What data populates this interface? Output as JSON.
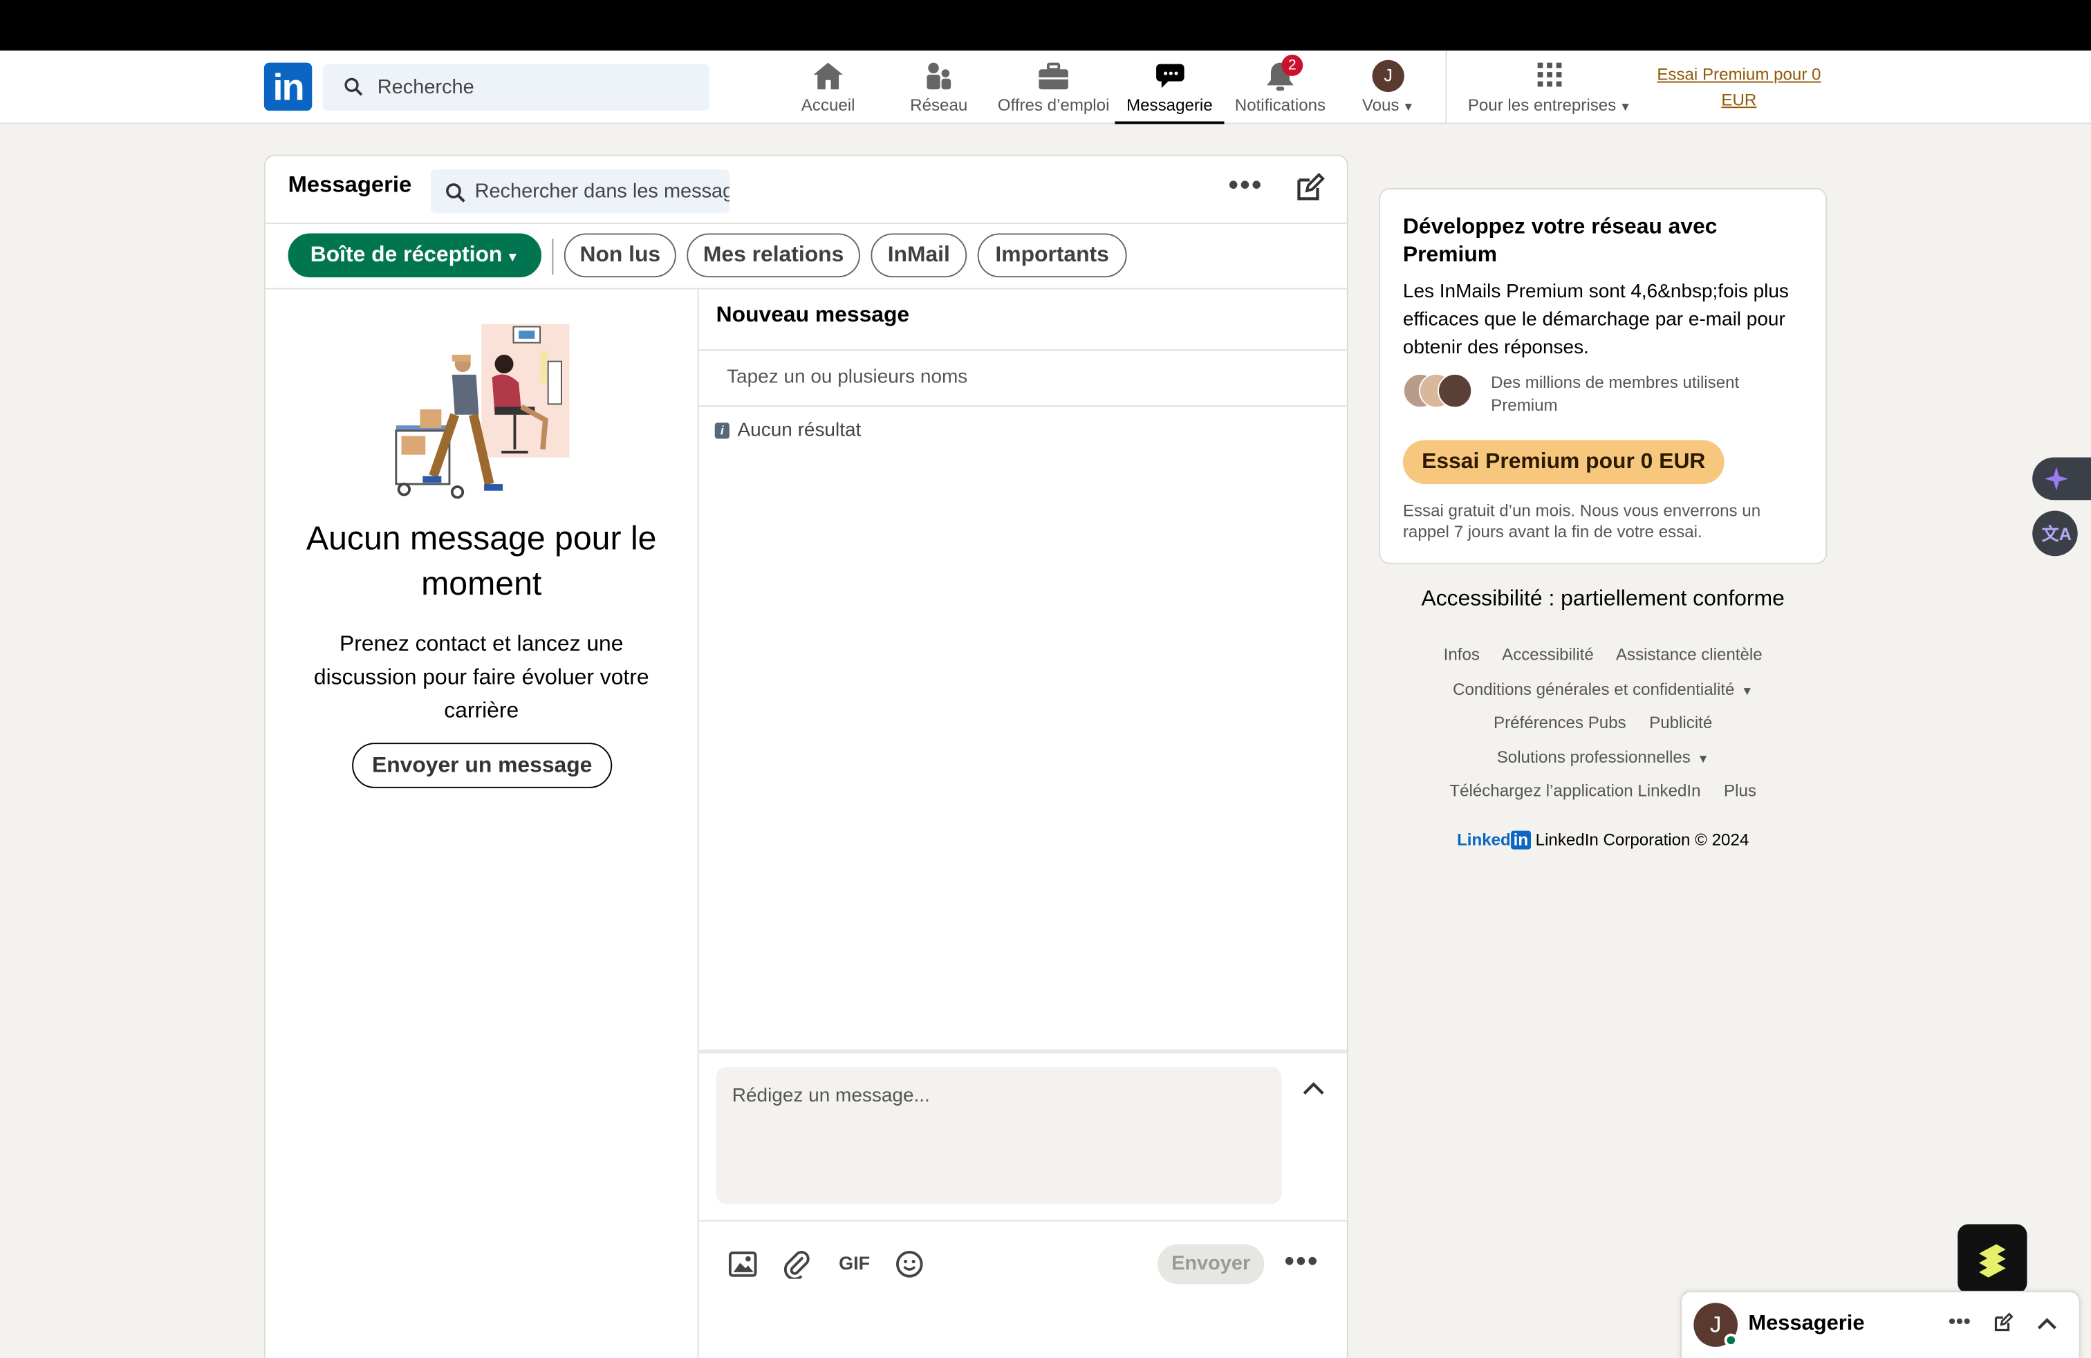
{
  "nav": {
    "search_placeholder": "Recherche",
    "items": [
      {
        "label": "Accueil"
      },
      {
        "label": "Réseau"
      },
      {
        "label": "Offres d’emploi"
      },
      {
        "label": "Messagerie"
      },
      {
        "label": "Notifications",
        "badge": "2"
      },
      {
        "label": "Vous",
        "avatar_initial": "J"
      }
    ],
    "business": "Pour les entreprises",
    "premium_link": "Essai Premium pour 0 EUR"
  },
  "messaging": {
    "title": "Messagerie",
    "search_placeholder": "Rechercher dans les messages",
    "filters": [
      "Boîte de réception",
      "Non lus",
      "Mes relations",
      "InMail",
      "Importants"
    ],
    "empty": {
      "title": "Aucun message pour le moment",
      "subtitle": "Prenez contact et lancez une discussion pour faire évoluer votre carrière",
      "button": "Envoyer un message"
    },
    "compose": {
      "title": "Nouveau message",
      "recipients_placeholder": "Tapez un ou plusieurs noms",
      "no_result": "Aucun résultat",
      "message_placeholder": "Rédigez un message...",
      "gif": "GIF",
      "send": "Envoyer"
    }
  },
  "premium_card": {
    "title": "Développez votre réseau avec Premium",
    "body": "Les InMails Premium sont 4,6&nbsp;fois plus efficaces que le démarchage par e-mail pour obtenir des réponses.",
    "members": "Des millions de membres utilisent Premium",
    "cta": "Essai Premium pour 0 EUR",
    "note": "Essai gratuit d’un mois. Nous vous enverrons un rappel 7 jours avant la fin de votre essai."
  },
  "footer": {
    "accessibility": "Accessibilité : partiellement conforme",
    "links": {
      "infos": "Infos",
      "accessibilite": "Accessibilité",
      "assistance": "Assistance clientèle",
      "conditions": "Conditions générales et confidentialité",
      "preferences": "Préférences Pubs",
      "publicite": "Publicité",
      "solutions": "Solutions professionnelles",
      "app": "Téléchargez l’application LinkedIn",
      "plus": "Plus"
    },
    "brand": "Linked",
    "brand_in": "in",
    "copyright": "LinkedIn Corporation © 2024"
  },
  "dock": {
    "avatar_initial": "J",
    "title": "Messagerie"
  },
  "colors": {
    "brand_blue": "#0a66c2",
    "inbox_green": "#01754f",
    "premium_gold": "#f8c77e",
    "premium_link": "#915907",
    "badge_red": "#cb112d"
  }
}
